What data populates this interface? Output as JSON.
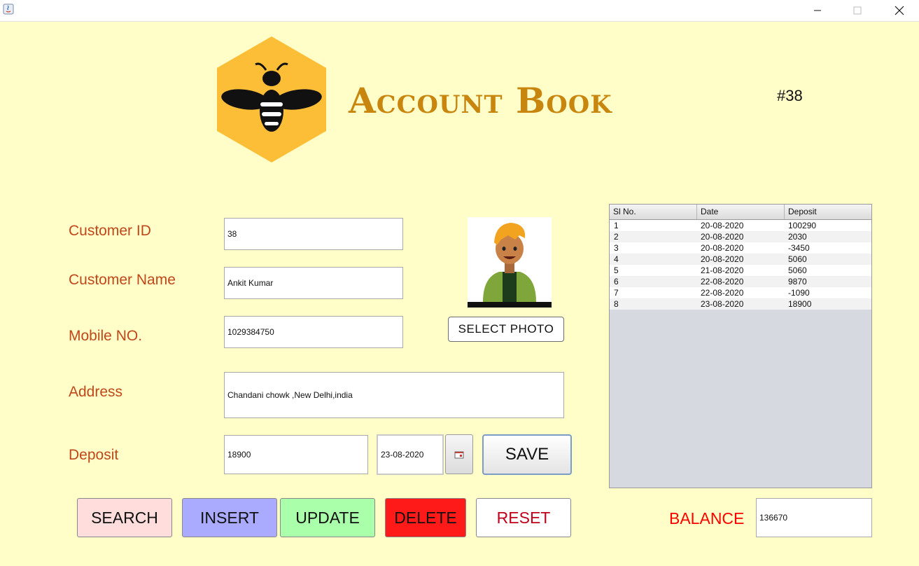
{
  "window": {
    "minimize_icon": "minimize-icon",
    "maximize_icon": "maximize-icon",
    "close_icon": "close-icon"
  },
  "header": {
    "logo_icon": "bee-hexagon-logo",
    "title": "Account Book",
    "record_number": "#38"
  },
  "colors": {
    "background": "#FFFEC8",
    "label": "#C0471A",
    "title": "#C8860F",
    "search_button": "#FFDDDD",
    "insert_button": "#AAAAFF",
    "update_button": "#AAFFAA",
    "delete_button": "#FF1A1A",
    "reset_button": "#FFFFFF",
    "balance_label": "#FF0000",
    "table_background": "#D7D9E0"
  },
  "form": {
    "customer_id": {
      "label": "Customer ID",
      "value": "38"
    },
    "customer_name": {
      "label": "Customer Name",
      "value": "Ankit Kumar"
    },
    "mobile": {
      "label": "Mobile NO.",
      "value": "1029384750"
    },
    "address": {
      "label": "Address",
      "value": "Chandani chowk ,New Delhi,india"
    },
    "deposit": {
      "label": "Deposit",
      "value": "18900",
      "date": "23-08-2020",
      "calendar_icon": "calendar-icon"
    },
    "photo_button": "SELECT PHOTO",
    "save_button": "SAVE"
  },
  "actions": {
    "search": "SEARCH",
    "insert": "INSERT",
    "update": "UPDATE",
    "delete": "DELETE",
    "reset": "RESET"
  },
  "balance": {
    "label": "BALANCE",
    "value": "136670"
  },
  "table": {
    "columns": [
      "Sl No.",
      "Date",
      "Deposit"
    ],
    "rows": [
      [
        "1",
        "20-08-2020",
        "100290"
      ],
      [
        "2",
        "20-08-2020",
        "2030"
      ],
      [
        "3",
        "20-08-2020",
        "-3450"
      ],
      [
        "4",
        "20-08-2020",
        "5060"
      ],
      [
        "5",
        "21-08-2020",
        "5060"
      ],
      [
        "6",
        "22-08-2020",
        "9870"
      ],
      [
        "7",
        "22-08-2020",
        "-1090"
      ],
      [
        "8",
        "23-08-2020",
        "18900"
      ]
    ]
  }
}
